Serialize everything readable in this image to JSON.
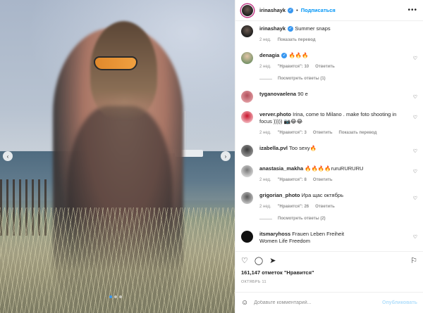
{
  "header": {
    "username": "irinashayk",
    "separator": "•",
    "follow_label": "Подписаться",
    "more_label": "•••"
  },
  "caption": {
    "username": "irinashayk",
    "text": "Summer snaps",
    "age": "2 нед.",
    "translate": "Показать перевод"
  },
  "comments": [
    {
      "username": "denagia",
      "verified": true,
      "text": "🔥🔥🔥",
      "age": "2 нед.",
      "likes": "\"Нравится\": 10",
      "reply": "Ответить",
      "replies": "Посмотреть ответы (1)"
    },
    {
      "username": "tyganovaelena",
      "text": "90 е",
      "age": "",
      "likes": "",
      "reply": ""
    },
    {
      "username": "verver.photo",
      "text": "Irina, come to Milano . make foto shooting in focus ))))) 📷😂😂",
      "age": "2 нед.",
      "likes": "\"Нравится\": 3",
      "reply": "Ответить",
      "translate": "Показать перевод"
    },
    {
      "username": "izabella.pvl",
      "text": "Too sexy🔥",
      "age": "",
      "likes": "",
      "reply": ""
    },
    {
      "username": "anastasia_makha",
      "text": "🔥🔥🔥🔥ruruRURURU",
      "age": "2 нед.",
      "likes": "\"Нравится\": 8",
      "reply": "Ответить"
    },
    {
      "username": "grigorian_photo",
      "text": "Ира щас октябрь",
      "age": "2 нед.",
      "likes": "\"Нравится\": 26",
      "reply": "Ответить",
      "replies": "Посмотреть ответы (2)"
    },
    {
      "username": "itsmaryhoss",
      "text": "Frauen Leben Freiheit",
      "text2": "Women Life Freedom"
    }
  ],
  "likes": "161,147 отметок \"Нравится\"",
  "date": "ОКТЯБРЬ 11",
  "add_comment": {
    "placeholder": "Добавьте комментарий...",
    "publish": "Опубликовать"
  },
  "icons": {
    "heart": "heart-icon",
    "comment": "comment-icon",
    "share": "share-icon",
    "save": "bookmark-icon",
    "emoji": "smiley-icon"
  },
  "colors": {
    "accent": "#0095f6",
    "publish_disabled": "#b2dffc",
    "muted": "#8e8e8e"
  }
}
